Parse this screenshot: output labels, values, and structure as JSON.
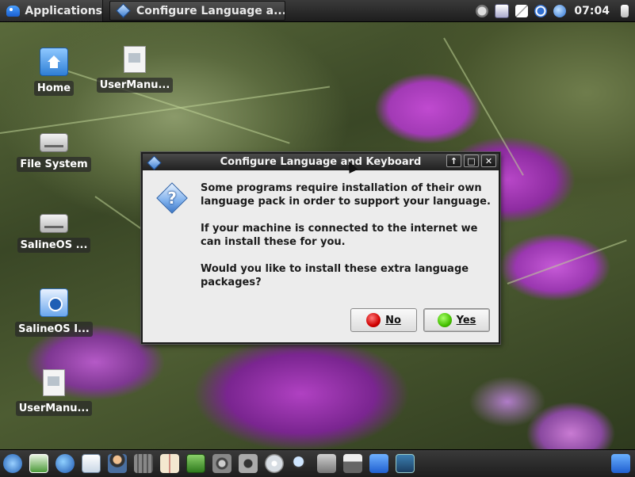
{
  "top_panel": {
    "applications_label": "Applications",
    "task_title": "Configure Language a...",
    "clock": "07:04",
    "tray_icons": [
      "volume-icon",
      "keyboard-icon",
      "network-icon",
      "update-icon",
      "globe-icon",
      "logout-icon"
    ]
  },
  "desktop_icons": [
    {
      "label": "Home",
      "icon": "home-folder-icon"
    },
    {
      "label": "UserManu...",
      "icon": "document-icon"
    },
    {
      "label": "File System",
      "icon": "drive-icon"
    },
    {
      "label": "SalineOS ...",
      "icon": "optical-drive-icon"
    },
    {
      "label": "SalineOS I...",
      "icon": "installer-icon"
    },
    {
      "label": "UserManu...",
      "icon": "document-icon"
    }
  ],
  "dialog": {
    "title": "Configure Language and Keyboard",
    "message_1": "Some programs require installation of their own language pack in order to support your language.",
    "message_2": "If your machine is connected to the internet we can install these for you.",
    "message_3": "Would you like to install these extra language packages?",
    "no_label": "No",
    "yes_label": "Yes",
    "wm_buttons": [
      "up-arrow-icon",
      "maximize-icon",
      "close-icon"
    ]
  },
  "dock": {
    "icons": [
      "saline-icon",
      "image-viewer-icon",
      "firefox-icon",
      "text-editor-icon",
      "user-admin-icon",
      "calculator-icon",
      "dictionary-icon",
      "system-monitor-icon",
      "speaker-icon",
      "camera-icon",
      "disc-burner-icon",
      "search-icon",
      "network-config-icon",
      "printer-icon",
      "file-manager-icon",
      "terminal-icon"
    ],
    "right_icon": "trash-icon"
  },
  "colors": {
    "panel_bg": "#2a2a2a",
    "dialog_bg": "#ececec",
    "accent_blue": "#3f7fd0",
    "no_button_red": "#d00000",
    "yes_button_green": "#44c000"
  }
}
